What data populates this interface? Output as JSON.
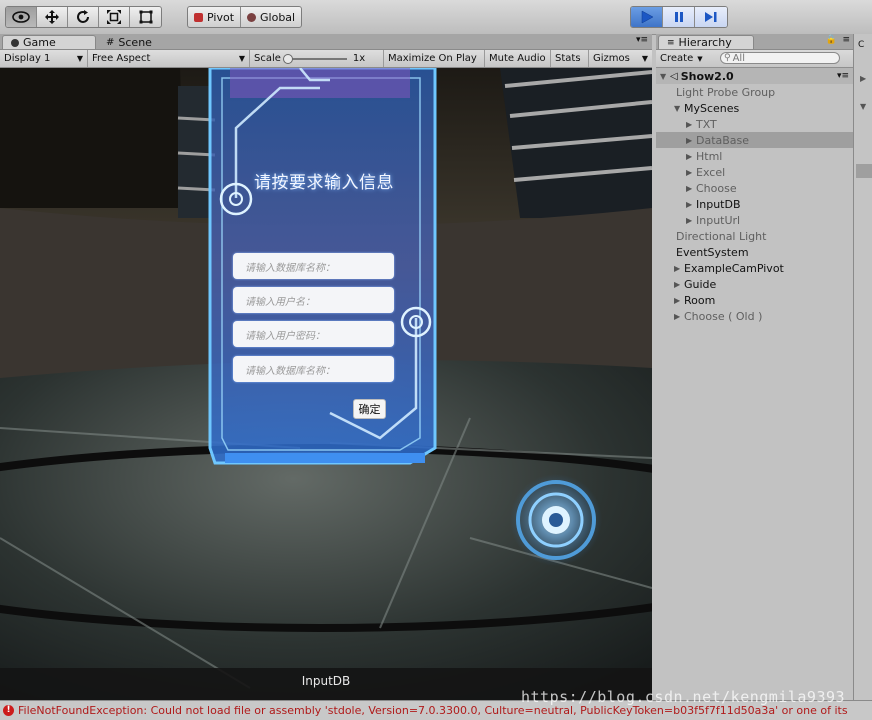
{
  "toolbar": {
    "pivot_label": "Pivot",
    "global_label": "Global",
    "transform_tools": [
      "view-hand-icon",
      "move-icon",
      "rotate-icon",
      "scale-icon",
      "rect-icon"
    ],
    "play_controls": [
      "play-icon",
      "pause-icon",
      "step-icon"
    ],
    "accent": "#3a74cf"
  },
  "tabs": {
    "game": "Game",
    "scene": "Scene",
    "hierarchy": "Hierarchy"
  },
  "gamebar": {
    "display": "Display 1",
    "aspect": "Free Aspect",
    "scale_label": "Scale",
    "scale_value": "1x",
    "maximize": "Maximize On Play",
    "mute": "Mute Audio",
    "stats": "Stats",
    "gizmos": "Gizmos"
  },
  "game": {
    "panel_title": "请按要求输入信息",
    "field1_placeholder": "请输入数据库名称：",
    "field2_placeholder": "请输入用户名：",
    "field3_placeholder": "请输入用户密码：",
    "field4_placeholder": "请输入数据库名称：",
    "confirm_label": "确定",
    "caption": "InputDB"
  },
  "hierarchy": {
    "create_label": "Create",
    "search_placeholder": "All",
    "scene_name": "Show2.0",
    "items": [
      {
        "label": "Light Probe Group",
        "indent": 1,
        "arrow": false,
        "grey": true,
        "selected": false
      },
      {
        "label": "MyScenes",
        "indent": 1,
        "arrow": "open",
        "grey": false,
        "selected": false
      },
      {
        "label": "TXT",
        "indent": 2,
        "arrow": "closed",
        "grey": true,
        "selected": false
      },
      {
        "label": "DataBase",
        "indent": 2,
        "arrow": "closed",
        "grey": true,
        "selected": true
      },
      {
        "label": "Html",
        "indent": 2,
        "arrow": "closed",
        "grey": true,
        "selected": false
      },
      {
        "label": "Excel",
        "indent": 2,
        "arrow": "closed",
        "grey": true,
        "selected": false
      },
      {
        "label": "Choose",
        "indent": 2,
        "arrow": "closed",
        "grey": true,
        "selected": false
      },
      {
        "label": "InputDB",
        "indent": 2,
        "arrow": "closed",
        "grey": false,
        "selected": false
      },
      {
        "label": "InputUrl",
        "indent": 2,
        "arrow": "closed",
        "grey": true,
        "selected": false
      },
      {
        "label": "Directional Light",
        "indent": 1,
        "arrow": false,
        "grey": true,
        "selected": false
      },
      {
        "label": "EventSystem",
        "indent": 1,
        "arrow": false,
        "grey": false,
        "selected": false
      },
      {
        "label": "ExampleCamPivot",
        "indent": 1,
        "arrow": "closed",
        "grey": false,
        "selected": false
      },
      {
        "label": "Guide",
        "indent": 1,
        "arrow": "closed",
        "grey": false,
        "selected": false
      },
      {
        "label": "Room",
        "indent": 1,
        "arrow": "closed",
        "grey": false,
        "selected": false
      },
      {
        "label": "Choose ( Old )",
        "indent": 1,
        "arrow": "closed",
        "grey": true,
        "selected": false
      }
    ]
  },
  "console": {
    "message": "FileNotFoundException: Could not load file or assembly 'stdole, Version=7.0.3300.0, Culture=neutral, PublicKeyToken=b03f5f7f11d50a3a' or one of its",
    "status_color": "#cc1b1b"
  },
  "watermark": "https://blog.csdn.net/kengmila9393"
}
